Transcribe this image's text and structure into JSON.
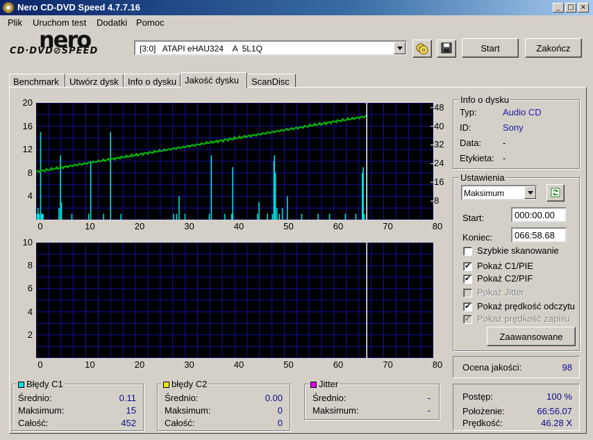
{
  "window": {
    "title": "Nero CD-DVD Speed 4.7.7.16",
    "minimize": "_",
    "maximize": "□",
    "close": "×"
  },
  "menu": [
    "Plik",
    "Uruchom test",
    "Dodatki",
    "Pomoc"
  ],
  "logo": {
    "main": "nero",
    "sub": "CD·DVD⊘SPEED"
  },
  "drive": {
    "selected": "[3:0]   ATAPI eHAU324    A  5L1Q"
  },
  "toolbar": {
    "start": "Start",
    "stop": "Zakończ"
  },
  "tabs": [
    "Benchmark",
    "Utwórz dysk",
    "Info o dysku",
    "Jakość dysku",
    "ScanDisc"
  ],
  "active_tab": "Jakość dysku",
  "colors": {
    "c1": "#00e0e0",
    "c2": "#e8e800",
    "jitter": "#e000e0",
    "speed": "#00c000",
    "grid": "#1010a0",
    "link": "#1a1aa0"
  },
  "chart_data": [
    {
      "type": "bar",
      "series": [
        {
          "name": "Błędy C1",
          "x": [
            0.2,
            0.4,
            0.6,
            0.9,
            1.1,
            1.3,
            1.4,
            4.6,
            4.9,
            5.1,
            7.2,
            10.6,
            11.0,
            13.6,
            15.0,
            17.1,
            27.7,
            28.3,
            28.8,
            30.0,
            34.9,
            35.3,
            38.0,
            39.4,
            39.6,
            44.6,
            44.9,
            46.6,
            47.6,
            47.9,
            48.0,
            48.2,
            48.5,
            49.0,
            49.6,
            50.6,
            53.5,
            56.8,
            59.1,
            62.3,
            64.4,
            65.7,
            65.9,
            66.1
          ],
          "values": [
            1,
            2,
            1,
            15,
            1,
            1,
            1,
            2,
            11,
            3,
            1,
            1,
            10,
            1,
            15,
            1,
            1,
            1,
            4,
            1,
            1,
            11,
            1,
            1,
            9,
            1,
            3,
            1,
            1,
            10,
            11,
            8,
            2,
            1,
            2,
            4,
            1,
            1,
            1,
            1,
            1,
            8,
            9,
            1
          ]
        }
      ],
      "speed_line": {
        "name": "Prędkość odczytu",
        "x": [
          0,
          66.6
        ],
        "y": [
          20.5,
          44.3
        ]
      },
      "xlim": [
        0,
        80
      ],
      "ylim": [
        0,
        20
      ],
      "y2lim": [
        0,
        50
      ],
      "x_ticks": [
        0,
        10,
        20,
        30,
        40,
        50,
        60,
        70,
        80
      ],
      "y_ticks": [
        4,
        8,
        12,
        16,
        20
      ],
      "y2_ticks": [
        8,
        16,
        24,
        32,
        40,
        48
      ],
      "end_marker_x": 66.6,
      "grid": true
    },
    {
      "type": "bar",
      "series": [
        {
          "name": "Błędy C2",
          "x": [],
          "values": []
        }
      ],
      "xlim": [
        0,
        80
      ],
      "ylim": [
        0,
        10
      ],
      "x_ticks": [
        0,
        10,
        20,
        30,
        40,
        50,
        60,
        70,
        80
      ],
      "y_ticks": [
        2,
        4,
        6,
        8,
        10
      ],
      "end_marker_x": 66.6,
      "grid": true
    }
  ],
  "disc_info": {
    "title": "Info o dysku",
    "rows": [
      {
        "label": "Typ:",
        "value": "Audio CD"
      },
      {
        "label": "ID:",
        "value": "Sony"
      },
      {
        "label": "Data:",
        "value": "-"
      },
      {
        "label": "Etykieta:",
        "value": "-"
      }
    ]
  },
  "settings": {
    "title": "Ustawienia",
    "mode": "Maksimum",
    "start_label": "Start:",
    "start_value": "000:00.00",
    "end_label": "Koniec:",
    "end_value": "066:58.68",
    "checkboxes": [
      {
        "label": "Szybkie skanowanie",
        "checked": false,
        "disabled": false
      },
      {
        "label": "Pokaż C1/PIE",
        "checked": true,
        "disabled": false
      },
      {
        "label": "Pokaż C2/PIF",
        "checked": true,
        "disabled": false
      },
      {
        "label": "Pokaż Jitter",
        "checked": false,
        "disabled": true
      },
      {
        "label": "Pokaż prędkość odczytu",
        "checked": true,
        "disabled": false
      },
      {
        "label": "Pokaż prędkość zapisu",
        "checked": true,
        "disabled": true
      }
    ],
    "advanced": "Zaawansowane"
  },
  "quality": {
    "label": "Ocena jakości:",
    "value": "98"
  },
  "c1_box": {
    "title": "Błędy C1",
    "rows": [
      {
        "label": "Średnio:",
        "value": "0.11"
      },
      {
        "label": "Maksimum:",
        "value": "15"
      },
      {
        "label": "Całość:",
        "value": "452"
      }
    ]
  },
  "c2_box": {
    "title": "błędy C2",
    "rows": [
      {
        "label": "Średnio:",
        "value": "0.00"
      },
      {
        "label": "Maksimum:",
        "value": "0"
      },
      {
        "label": "Całość:",
        "value": "0"
      }
    ]
  },
  "jitter_box": {
    "title": "Jitter",
    "rows": [
      {
        "label": "Średnio:",
        "value": "-"
      },
      {
        "label": "Maksimum:",
        "value": "-"
      }
    ]
  },
  "status": {
    "rows": [
      {
        "label": "Postęp:",
        "value": "100 %"
      },
      {
        "label": "Położenie:",
        "value": "66:56.07"
      },
      {
        "label": "Prędkość:",
        "value": "46.28 X"
      }
    ]
  }
}
